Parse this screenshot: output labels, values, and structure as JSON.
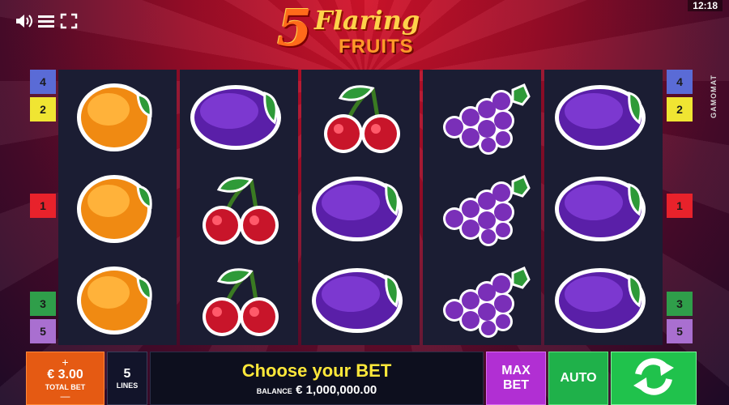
{
  "header": {
    "time": "12:18",
    "logo": {
      "number": "5",
      "word1": "Flaring",
      "word2": "FRUITS"
    },
    "brand": "GAMOMAT"
  },
  "icons": {
    "sound": "speaker-icon",
    "menu": "hamburger-menu-icon",
    "fullscreen": "fullscreen-icon"
  },
  "reels": [
    [
      "orange",
      "orange",
      "orange"
    ],
    [
      "plum",
      "cherry",
      "cherry"
    ],
    [
      "cherry",
      "plum",
      "plum"
    ],
    [
      "grapes",
      "grapes",
      "grapes"
    ],
    [
      "plum",
      "plum",
      "plum"
    ]
  ],
  "lines_left": [
    {
      "label": "4",
      "color": "#5a6bd6"
    },
    {
      "label": "2",
      "color": "#f0e532"
    },
    {
      "label": "1",
      "color": "#e8222b"
    },
    {
      "label": "3",
      "color": "#2f9e4a"
    },
    {
      "label": "5",
      "color": "#a96fd0"
    }
  ],
  "lines_right": [
    {
      "label": "4",
      "color": "#5a6bd6"
    },
    {
      "label": "2",
      "color": "#f0e532"
    },
    {
      "label": "1",
      "color": "#e8222b"
    },
    {
      "label": "3",
      "color": "#2f9e4a"
    },
    {
      "label": "5",
      "color": "#a96fd0"
    }
  ],
  "bottom": {
    "bet_plus": "+",
    "bet_value": "€ 3.00",
    "bet_label": "TOTAL BET",
    "bet_minus": "—",
    "lines_value": "5",
    "lines_label": "LINES",
    "message": "Choose your BET",
    "balance_label": "BALANCE",
    "balance_value": "€ 1,000,000.00",
    "max_bet": "MAX BET",
    "auto": "AUTO"
  }
}
